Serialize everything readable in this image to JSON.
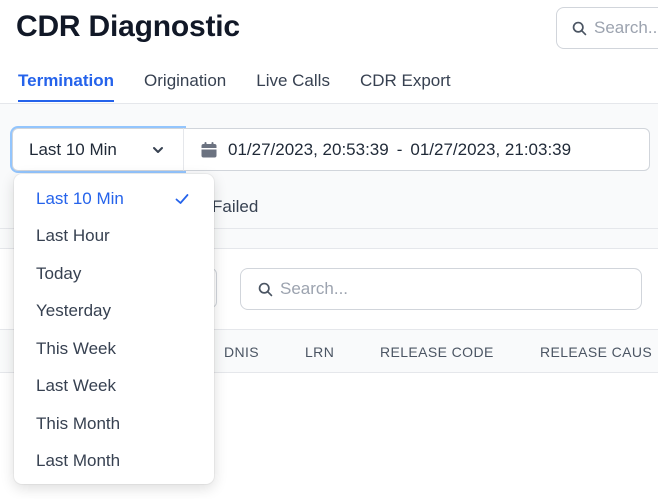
{
  "header": {
    "title": "CDR Diagnostic",
    "search_placeholder": "Search..."
  },
  "tabs": [
    {
      "label": "Termination",
      "active": true
    },
    {
      "label": "Origination",
      "active": false
    },
    {
      "label": "Live Calls",
      "active": false
    },
    {
      "label": "CDR Export",
      "active": false
    }
  ],
  "range": {
    "selected": "Last 10 Min",
    "from": "01/27/2023, 20:53:39",
    "separator": "-",
    "to": "01/27/2023, 21:03:39"
  },
  "dropdown": {
    "options": [
      {
        "label": "Last 10 Min",
        "selected": true
      },
      {
        "label": "Last Hour",
        "selected": false
      },
      {
        "label": "Today",
        "selected": false
      },
      {
        "label": "Yesterday",
        "selected": false
      },
      {
        "label": "This Week",
        "selected": false
      },
      {
        "label": "Last Week",
        "selected": false
      },
      {
        "label": "This Month",
        "selected": false
      },
      {
        "label": "Last Month",
        "selected": false
      }
    ]
  },
  "sub_tabs": {
    "failed_label": "Failed"
  },
  "table": {
    "search_placeholder": "Search...",
    "columns": [
      "DNIS",
      "LRN",
      "RELEASE CODE",
      "RELEASE CAUS"
    ]
  },
  "colors": {
    "accent": "#2563eb",
    "border": "#d1d5db",
    "muted_text": "#9ca3af"
  },
  "icons": {
    "search": "search-icon",
    "calendar": "calendar-icon",
    "chevron": "chevron-down-icon",
    "check": "check-icon"
  }
}
